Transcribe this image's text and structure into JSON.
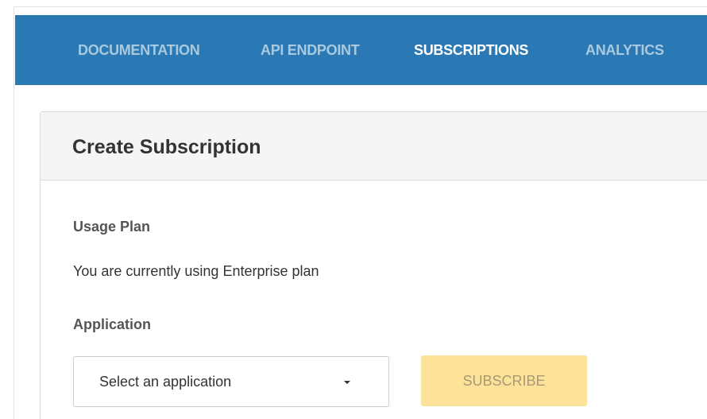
{
  "nav": {
    "tabs": [
      {
        "label": "DOCUMENTATION",
        "active": false
      },
      {
        "label": "API ENDPOINT",
        "active": false
      },
      {
        "label": "SUBSCRIPTIONS",
        "active": true
      },
      {
        "label": "ANALYTICS",
        "active": false
      }
    ],
    "background_color": "#2a79b5",
    "active_color": "#ffffff",
    "inactive_color": "#a9c9df"
  },
  "card": {
    "title": "Create Subscription",
    "usage_plan_label": "Usage Plan",
    "usage_plan_text": "You are currently using Enterprise plan",
    "application_label": "Application",
    "application_select": {
      "selected": "Select an application",
      "icon": "caret-down-icon"
    },
    "subscribe_button": {
      "label": "SUBSCRIBE",
      "color": "#fde29a",
      "disabled": true
    }
  }
}
